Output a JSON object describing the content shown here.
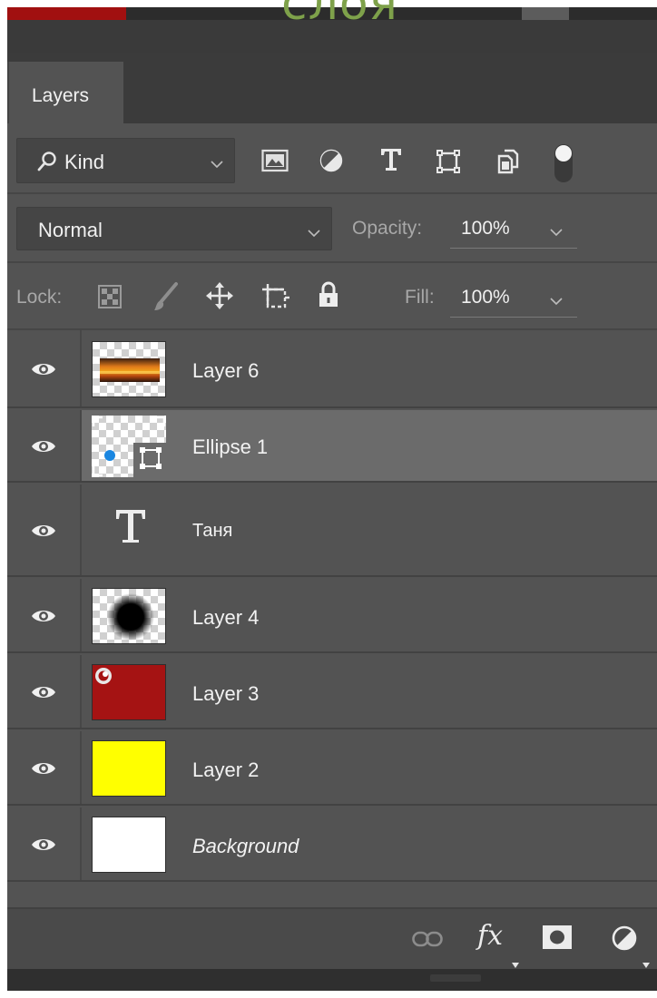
{
  "overlay_caption": "слоя",
  "panel": {
    "tab_label": "Layers"
  },
  "filter": {
    "kind_label": "Kind",
    "icons": [
      "search-icon",
      "image-filter-icon",
      "adjustment-filter-icon",
      "type-filter-icon",
      "shape-filter-icon",
      "smart-object-filter-icon",
      "filter-toggle-icon"
    ]
  },
  "blend": {
    "mode": "Normal",
    "opacity_label": "Opacity:",
    "opacity_value": "100%"
  },
  "lock": {
    "label": "Lock:",
    "icons": [
      "lock-transparent-pixels-icon",
      "lock-image-pixels-icon",
      "lock-position-icon",
      "lock-artboard-icon",
      "lock-all-icon"
    ],
    "fill_label": "Fill:",
    "fill_value": "100%"
  },
  "layers": [
    {
      "name": "Layer 6",
      "visible": true,
      "thumb": "sunset-image",
      "selected": false
    },
    {
      "name": "Ellipse 1",
      "visible": true,
      "thumb": "shape-ellipse",
      "selected": true
    },
    {
      "name": "Таня",
      "visible": true,
      "thumb": "type-layer",
      "selected": false
    },
    {
      "name": "Layer 4",
      "visible": true,
      "thumb": "black-blurred-circle",
      "selected": false
    },
    {
      "name": "Layer 3",
      "visible": true,
      "thumb": "red-fill",
      "selected": false
    },
    {
      "name": "Layer 2",
      "visible": true,
      "thumb": "yellow-fill",
      "selected": false
    },
    {
      "name": "Background",
      "visible": true,
      "thumb": "white-fill",
      "selected": false
    }
  ],
  "colors": {
    "panel_bg": "#535353",
    "selected_row": "#6b6b6b",
    "layer3_fill": "#a51313",
    "layer2_fill": "#ffff00",
    "background_fill": "#ffffff",
    "caption": "#7ea14a"
  },
  "bottom_icons": [
    "link-layers-icon",
    "fx-icon",
    "layer-mask-icon",
    "new-adjustment-layer-icon"
  ]
}
